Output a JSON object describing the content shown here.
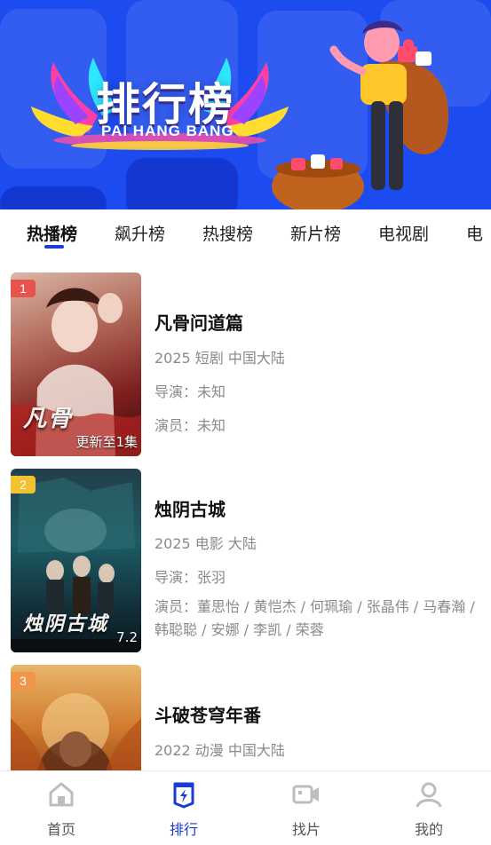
{
  "banner": {
    "title": "排行榜",
    "subtitle": "PAI HANG BANG"
  },
  "tabs": [
    {
      "label": "热播榜",
      "active": true
    },
    {
      "label": "飙升榜",
      "active": false
    },
    {
      "label": "热搜榜",
      "active": false
    },
    {
      "label": "新片榜",
      "active": false
    },
    {
      "label": "电视剧",
      "active": false
    },
    {
      "label": "电",
      "active": false
    }
  ],
  "list": [
    {
      "rank": "1",
      "rank_color": "#e8534d",
      "poster_note": "更新至1集",
      "poster_text": "凡骨",
      "title": "凡骨问道篇",
      "meta": "2025 短剧 中国大陆",
      "director": "导演：未知",
      "cast": "演员：未知"
    },
    {
      "rank": "2",
      "rank_color": "#f2c232",
      "poster_note": "7.2",
      "poster_text": "烛阴古城",
      "title": "烛阴古城",
      "meta": "2025 电影 大陆",
      "director": "导演：张羽",
      "cast": "演员：董思怡 / 黄恺杰 / 何珮瑜 / 张晶伟 / 马春瀚 / 韩聪聪 / 安娜 / 李凯 / 荣蓉"
    },
    {
      "rank": "3",
      "rank_color": "#f0964a",
      "poster_note": "",
      "poster_text": "",
      "title": "斗破苍穹年番",
      "meta": "2022 动漫 中国大陆"
    }
  ],
  "nav": [
    {
      "label": "首页",
      "icon": "home-icon",
      "active": false
    },
    {
      "label": "排行",
      "icon": "ranking-icon",
      "active": true
    },
    {
      "label": "找片",
      "icon": "video-camera-icon",
      "active": false
    },
    {
      "label": "我的",
      "icon": "user-icon",
      "active": false
    }
  ],
  "colors": {
    "banner_bg": "#1c4bf0",
    "accent": "#1a3bd8"
  }
}
